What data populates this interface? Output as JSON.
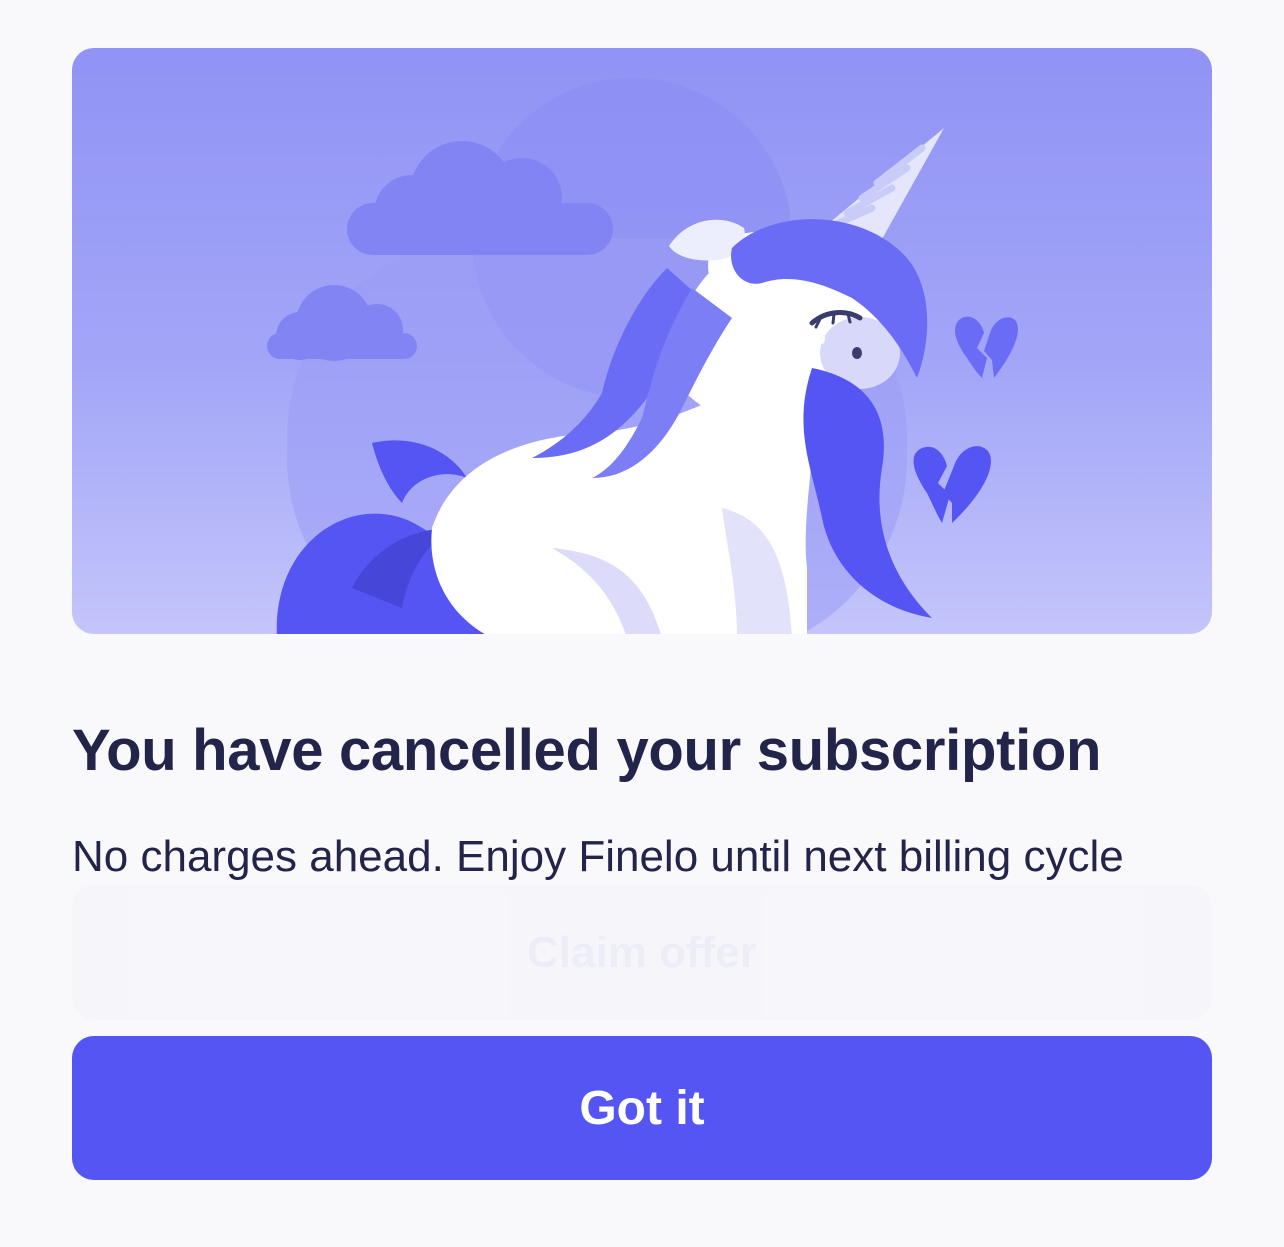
{
  "background": {
    "ghost_price_text": "",
    "ghost_button_label": "Claim offer"
  },
  "hero": {
    "illustration": "sad-unicorn-illustration",
    "colors": {
      "sky_top": "#9193f5",
      "sky_bottom": "#c4c5fb",
      "mane": "#5555f4",
      "body": "#ffffff"
    }
  },
  "content": {
    "title": "You have cancelled your subscription",
    "description": "No charges ahead. Enjoy Finelo until next billing cycle"
  },
  "actions": {
    "primary_label": "Got it"
  },
  "theme": {
    "accent": "#5555f4",
    "text_dark": "#22244a",
    "page_bg": "#f9f9fb"
  }
}
